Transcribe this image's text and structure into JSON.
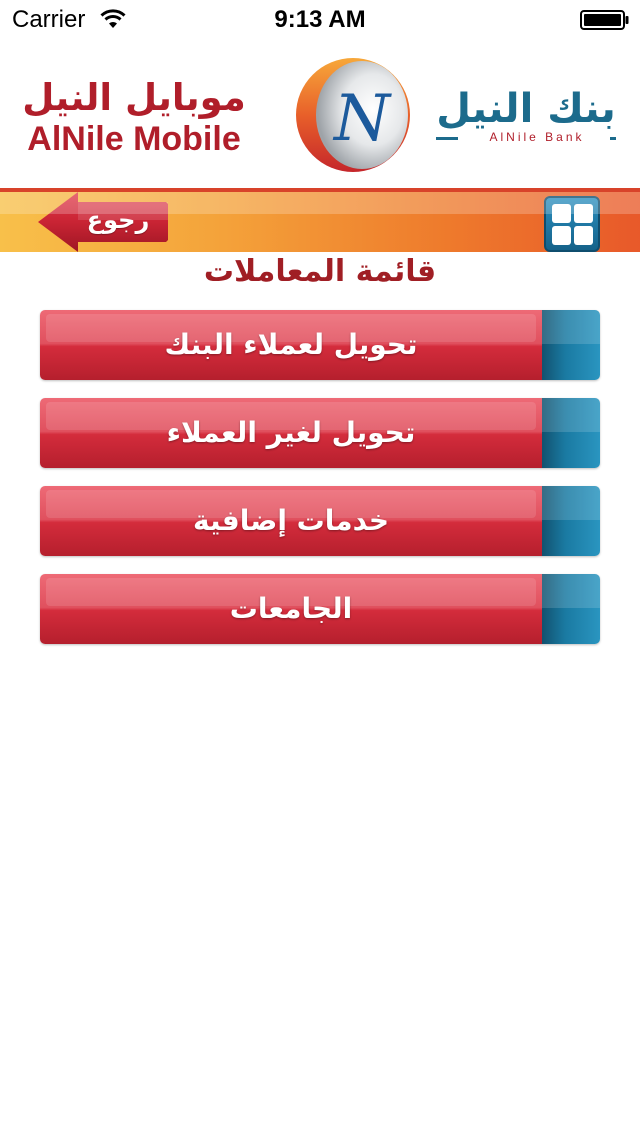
{
  "status_bar": {
    "carrier": "Carrier",
    "time": "9:13 AM",
    "wifi_icon": "wifi-icon",
    "battery_icon": "battery-icon"
  },
  "header": {
    "mobile_logo_ar": "موبايل النيل",
    "mobile_logo_en": "AlNile Mobile",
    "bank_logo_ar": "بنك النيل",
    "bank_logo_en": "AlNile Bank",
    "emblem_letter": "N",
    "brand_red": "#b01e2a",
    "brand_blue": "#1c6b8c"
  },
  "nav": {
    "back_label": "رجوع",
    "grid_icon": "grid-menu-icon"
  },
  "main": {
    "title": "قائمة المعاملات",
    "menu_items": [
      {
        "label": "تحويل لعملاء البنك"
      },
      {
        "label": "تحويل لغير العملاء"
      },
      {
        "label": "خدمات إضافية"
      },
      {
        "label": "الجامعات"
      }
    ]
  }
}
